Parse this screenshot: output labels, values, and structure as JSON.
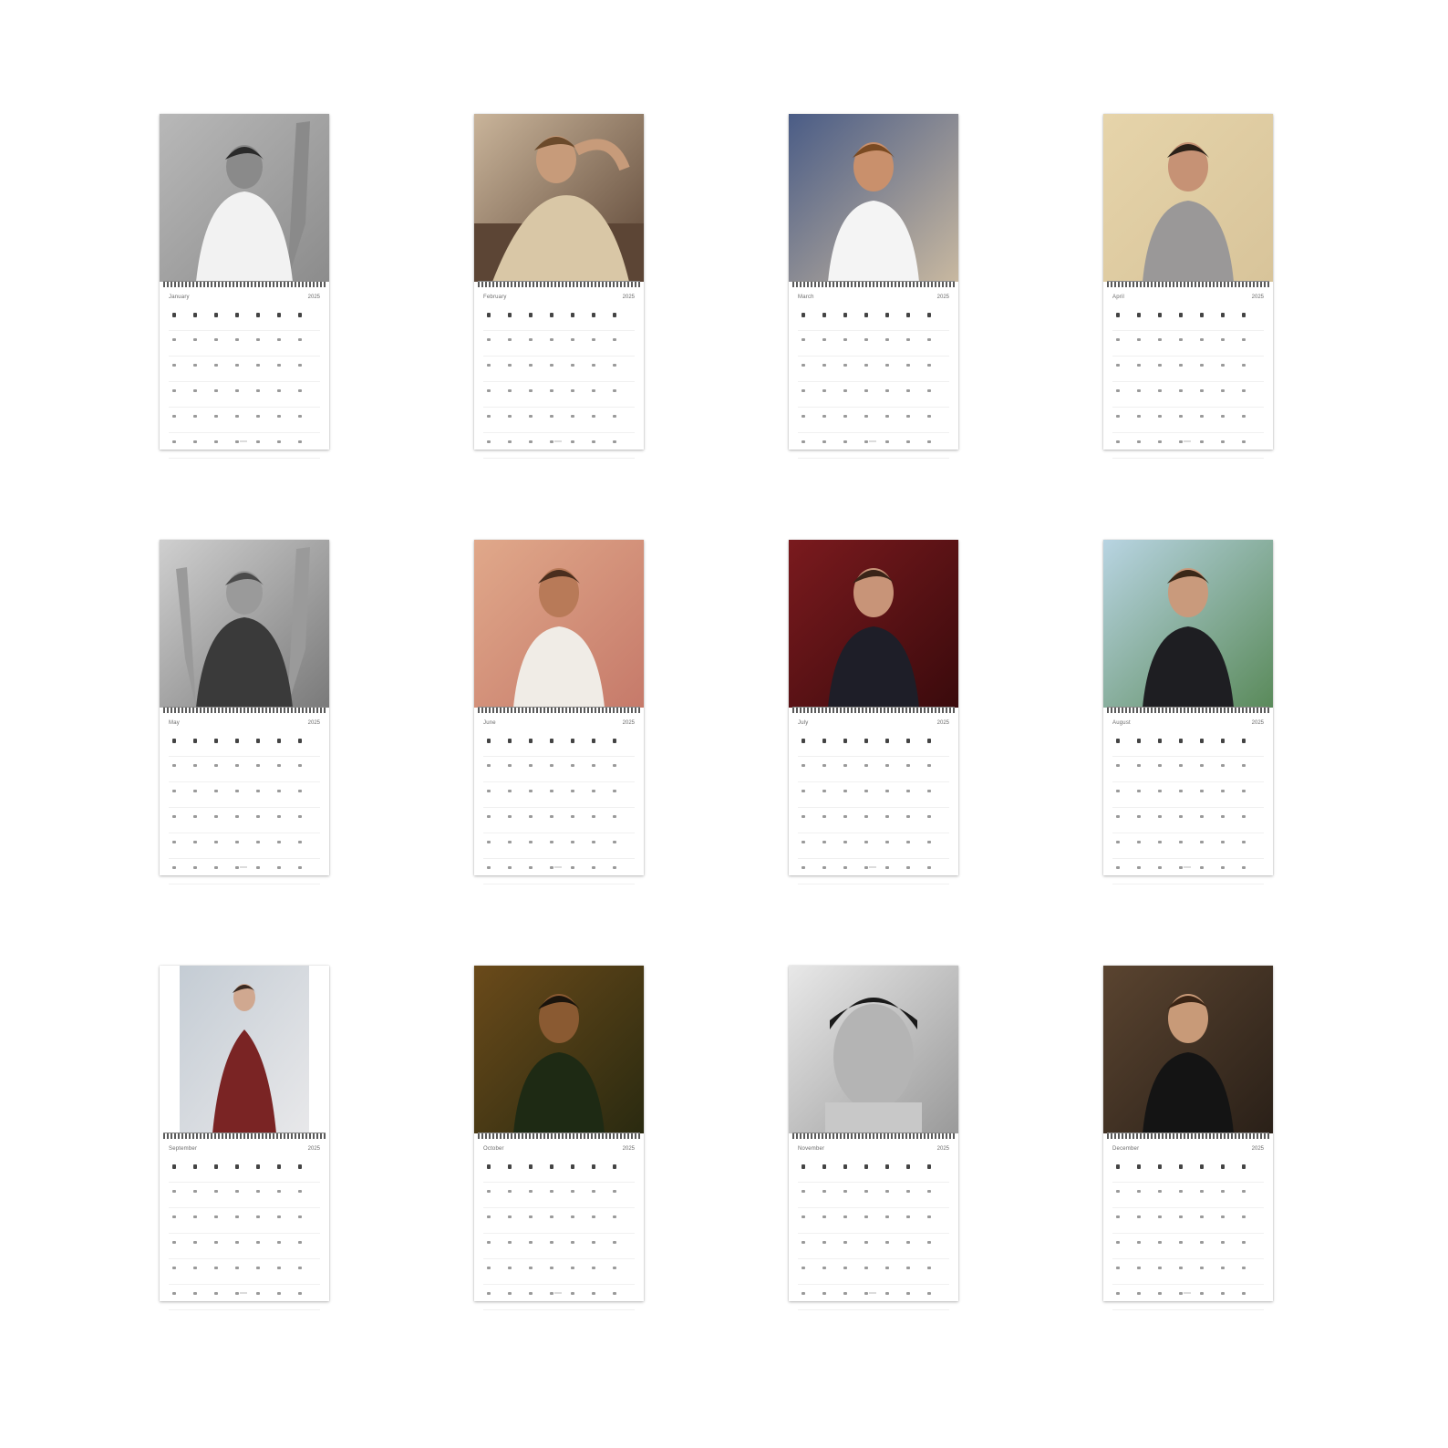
{
  "calendars": [
    {
      "month": "January",
      "year": "2025",
      "photo": {
        "bg": "#b8b8b8",
        "bg2": "#8c8c8c",
        "shirt": "#f2f2f2",
        "skin": "#8a8a8a",
        "hair": "#2a2a2a",
        "pose": "arm-up"
      }
    },
    {
      "month": "February",
      "year": "2025",
      "photo": {
        "bg": "#c9b49a",
        "bg2": "#5c4535",
        "shirt": "#d9c7a6",
        "skin": "#c79b7a",
        "hair": "#6b4a2b",
        "pose": "reclining"
      }
    },
    {
      "month": "March",
      "year": "2025",
      "photo": {
        "bg": "#4a5c86",
        "bg2": "#c8b8a0",
        "shirt": "#f4f4f4",
        "skin": "#c9906c",
        "hair": "#7a4a22",
        "pose": "front"
      }
    },
    {
      "month": "April",
      "year": "2025",
      "photo": {
        "bg": "#e6d4aa",
        "bg2": "#d8c49a",
        "shirt": "#9a9898",
        "skin": "#c69275",
        "hair": "#2a2018",
        "pose": "standing"
      }
    },
    {
      "month": "May",
      "year": "2025",
      "photo": {
        "bg": "#cfcfcf",
        "bg2": "#7a7a7a",
        "shirt": "#3a3a3a",
        "skin": "#9a9a9a",
        "hair": "#4a4a4a",
        "pose": "arms-up"
      }
    },
    {
      "month": "June",
      "year": "2025",
      "photo": {
        "bg": "#e0a88a",
        "bg2": "#c67a6a",
        "shirt": "#f0ece6",
        "skin": "#b87a58",
        "hair": "#4a2e1e",
        "pose": "standing"
      }
    },
    {
      "month": "July",
      "year": "2025",
      "photo": {
        "bg": "#7a1a1e",
        "bg2": "#3a0a0c",
        "shirt": "#1e1e28",
        "skin": "#c89478",
        "hair": "#3a2418",
        "pose": "front"
      }
    },
    {
      "month": "August",
      "year": "2025",
      "photo": {
        "bg": "#b8d4e2",
        "bg2": "#5a8a5a",
        "shirt": "#1e1e22",
        "skin": "#c99a7c",
        "hair": "#3a2818",
        "pose": "front"
      }
    },
    {
      "month": "September",
      "year": "2025",
      "photo": {
        "bg": "#c4ccd4",
        "bg2": "#e8e8ea",
        "shirt": "#7a2424",
        "skin": "#d0a890",
        "hair": "#3a2a22",
        "pose": "standing-narrow"
      }
    },
    {
      "month": "October",
      "year": "2025",
      "photo": {
        "bg": "#6a4a1a",
        "bg2": "#2a2a10",
        "shirt": "#1e2a14",
        "skin": "#8a5a32",
        "hair": "#1a140c",
        "pose": "front"
      }
    },
    {
      "month": "November",
      "year": "2025",
      "photo": {
        "bg": "#e8e8e8",
        "bg2": "#9a9a9a",
        "shirt": "#c8c8c8",
        "skin": "#b4b4b4",
        "hair": "#1a1a1a",
        "pose": "closeup"
      }
    },
    {
      "month": "December",
      "year": "2025",
      "photo": {
        "bg": "#5a4430",
        "bg2": "#2a2018",
        "shirt": "#141414",
        "skin": "#c89a78",
        "hair": "#3a2414",
        "pose": "front"
      }
    }
  ]
}
